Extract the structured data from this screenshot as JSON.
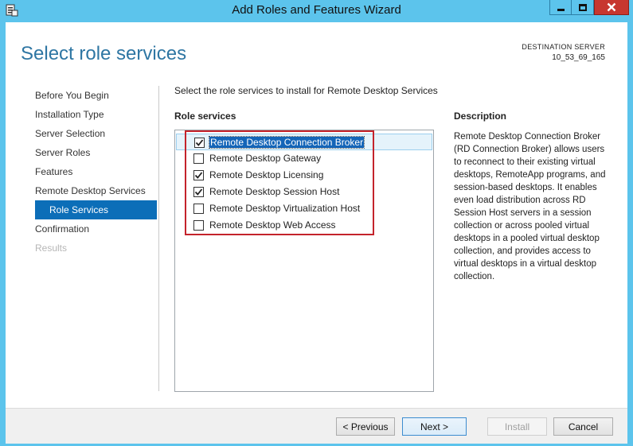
{
  "window": {
    "title": "Add Roles and Features Wizard",
    "accent_color": "#5cc4ec",
    "close_color": "#c7372f"
  },
  "page": {
    "heading": "Select role services",
    "destination_label": "DESTINATION SERVER",
    "destination_value": "10_53_69_165"
  },
  "nav": {
    "items": [
      {
        "label": "Before You Begin",
        "state": "normal"
      },
      {
        "label": "Installation Type",
        "state": "normal"
      },
      {
        "label": "Server Selection",
        "state": "normal"
      },
      {
        "label": "Server Roles",
        "state": "normal"
      },
      {
        "label": "Features",
        "state": "normal"
      },
      {
        "label": "Remote Desktop Services",
        "state": "normal"
      },
      {
        "label": "Role Services",
        "state": "active"
      },
      {
        "label": "Confirmation",
        "state": "normal"
      },
      {
        "label": "Results",
        "state": "disabled"
      }
    ],
    "active_color": "#0c6eb8"
  },
  "main": {
    "instruction": "Select the role services to install for Remote Desktop Services",
    "role_services_label": "Role services",
    "role_services": [
      {
        "label": "Remote Desktop Connection Broker",
        "checked": true,
        "selected": true
      },
      {
        "label": "Remote Desktop Gateway",
        "checked": false,
        "selected": false
      },
      {
        "label": "Remote Desktop Licensing",
        "checked": true,
        "selected": false
      },
      {
        "label": "Remote Desktop Session Host",
        "checked": true,
        "selected": false
      },
      {
        "label": "Remote Desktop Virtualization Host",
        "checked": false,
        "selected": false
      },
      {
        "label": "Remote Desktop Web Access",
        "checked": false,
        "selected": false
      }
    ],
    "highlight_color": "#c4232b"
  },
  "description": {
    "title": "Description",
    "body": "Remote Desktop Connection Broker (RD Connection Broker) allows users to reconnect to their existing virtual desktops, RemoteApp programs, and session-based desktops. It enables even load distribution across RD Session Host servers in a session collection or across pooled virtual desktops in a pooled virtual desktop collection, and provides access to virtual desktops in a virtual desktop collection."
  },
  "footer": {
    "previous_label": "< Previous",
    "next_label": "Next >",
    "install_label": "Install",
    "cancel_label": "Cancel"
  }
}
